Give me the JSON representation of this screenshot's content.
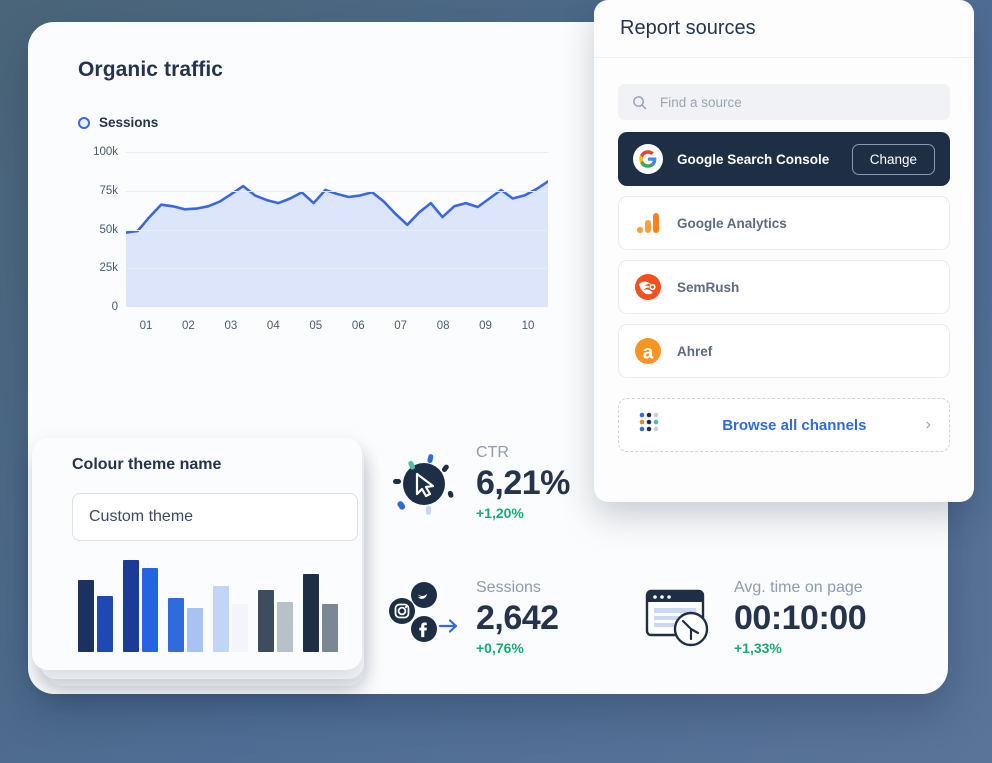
{
  "chart_card": {
    "title": "Organic traffic",
    "legend": [
      {
        "label": "Sessions",
        "color": "#3b68e0"
      }
    ]
  },
  "chart_data": {
    "type": "area",
    "title": "Organic traffic",
    "xlabel": "",
    "ylabel": "",
    "ylim": [
      0,
      100000
    ],
    "yticks": [
      "0",
      "25k",
      "50k",
      "75k",
      "100k"
    ],
    "ytick_values": [
      0,
      25000,
      50000,
      75000,
      100000
    ],
    "xticks": [
      "01",
      "02",
      "03",
      "04",
      "05",
      "06",
      "07",
      "08",
      "09",
      "10"
    ],
    "grid": true,
    "legend_position": "top-left",
    "line_color": "#3b68e0",
    "fill_color": "#dde5fa",
    "series": [
      {
        "name": "Sessions",
        "values": [
          48000,
          49000,
          58000,
          66000,
          65000,
          63000,
          63500,
          65000,
          68000,
          73000,
          78000,
          72000,
          69000,
          67000,
          70000,
          74000,
          67000,
          75500,
          73000,
          71000,
          72000,
          74000,
          68000,
          60000,
          53000,
          61000,
          67000,
          58000,
          65000,
          67000,
          64500,
          70000,
          75500,
          70000,
          72000,
          76000,
          81000
        ]
      }
    ]
  },
  "theme_card": {
    "title": "Colour theme name",
    "input_value": "Custom theme",
    "input_placeholder": "Custom theme",
    "palette_chart": {
      "type": "bar",
      "pairs": [
        {
          "primary": "#1b315f",
          "secondary": "#1f49b0",
          "primary_height": 72,
          "secondary_height": 56
        },
        {
          "primary": "#1b3b96",
          "secondary": "#2563e0",
          "primary_height": 92,
          "secondary_height": 84
        },
        {
          "primary": "#2f6bdd",
          "secondary": "#a9c2f4",
          "primary_height": 54,
          "secondary_height": 44
        },
        {
          "primary": "#c2d4f8",
          "secondary": "#f2f5fc",
          "primary_height": 66,
          "secondary_height": 48
        },
        {
          "primary": "#3e4d5d",
          "secondary": "#b9c1c8",
          "primary_height": 62,
          "secondary_height": 50
        },
        {
          "primary": "#1e2f45",
          "secondary": "#7b8795",
          "primary_height": 78,
          "secondary_height": 48
        }
      ]
    }
  },
  "kpis": [
    {
      "id": "ctr",
      "label": "CTR",
      "value": "6,21%",
      "delta": "+1,20%",
      "delta_color": "#1aa87a",
      "icon": "cursor-click-icon"
    },
    {
      "id": "sessions",
      "label": "Sessions",
      "value": "2,642",
      "delta": "+0,76%",
      "delta_color": "#1aa87a",
      "icon": "social-networks-icon"
    },
    {
      "id": "avg_time",
      "label": "Avg. time on page",
      "value": "00:10:00",
      "delta": "+1,33%",
      "delta_color": "#1aa87a",
      "icon": "browser-clock-icon"
    }
  ],
  "panel": {
    "title": "Report sources",
    "search": {
      "placeholder": "Find a source",
      "value": "",
      "icon": "search-icon"
    },
    "sources": [
      {
        "name": "Google Search Console",
        "icon": "google-icon",
        "active": true,
        "action_label": "Change"
      },
      {
        "name": "Google Analytics",
        "icon": "google-analytics-icon",
        "active": false
      },
      {
        "name": "SemRush",
        "icon": "semrush-icon",
        "active": false
      },
      {
        "name": "Ahref",
        "icon": "ahref-icon",
        "active": false
      }
    ],
    "browse": {
      "label": "Browse all channels",
      "icon": "dot-grid-icon",
      "chevron": "›"
    }
  },
  "colors": {
    "accent_blue": "#2f6bdd",
    "dark_navy": "#1e2f45",
    "green": "#1aa87a",
    "orange": "#f58220",
    "background": "#4f6d94"
  }
}
